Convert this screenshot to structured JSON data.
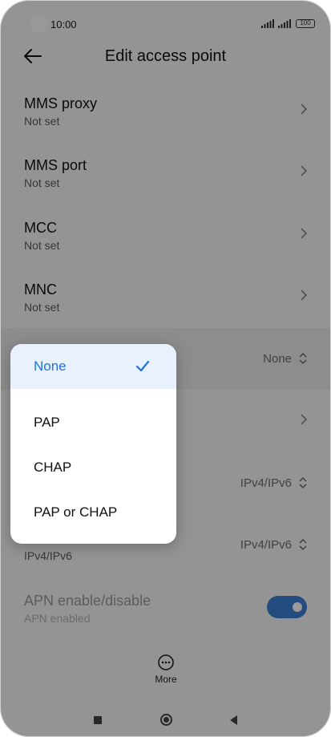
{
  "status_bar": {
    "time": "10:00",
    "battery": "100"
  },
  "header": {
    "title": "Edit access point"
  },
  "rows": [
    {
      "title": "MMS proxy",
      "subtitle": "Not set"
    },
    {
      "title": "MMS port",
      "subtitle": "Not set"
    },
    {
      "title": "MCC",
      "subtitle": "Not set"
    },
    {
      "title": "MNC",
      "subtitle": "Not set"
    }
  ],
  "auth_row": {
    "value": "None"
  },
  "protocol_row": {
    "value": "IPv4/IPv6"
  },
  "roaming_row": {
    "subtitle": "IPv4/IPv6",
    "value": "IPv4/IPv6"
  },
  "apn_row": {
    "title": "APN enable/disable",
    "subtitle": "APN enabled",
    "toggle_on": true
  },
  "more": {
    "label": "More"
  },
  "popup": {
    "options": [
      "None",
      "PAP",
      "CHAP",
      "PAP or CHAP"
    ],
    "selected": "None"
  },
  "colors": {
    "accent": "#1a73e8",
    "toggle": "#3f7fd6",
    "selected_bg": "#e8f1fd"
  }
}
